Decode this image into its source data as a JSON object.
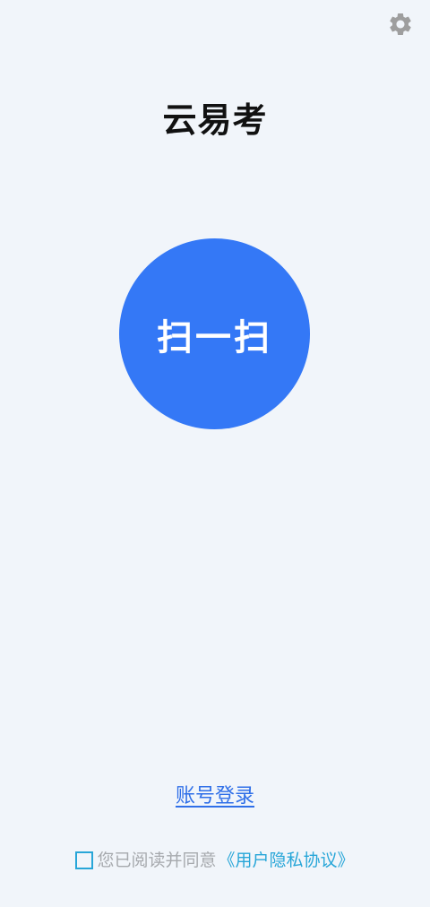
{
  "header": {
    "settings_icon": "gear-icon",
    "icon_color": "#9e9e9e"
  },
  "app": {
    "title": "云易考"
  },
  "scan": {
    "label": "扫一扫",
    "color": "#3478f6"
  },
  "login": {
    "label": "账号登录",
    "color": "#2f6fe8"
  },
  "agreement": {
    "checked": false,
    "text": "您已阅读并同意",
    "link_label": "《用户隐私协议》",
    "link_color": "#28a6d8"
  }
}
